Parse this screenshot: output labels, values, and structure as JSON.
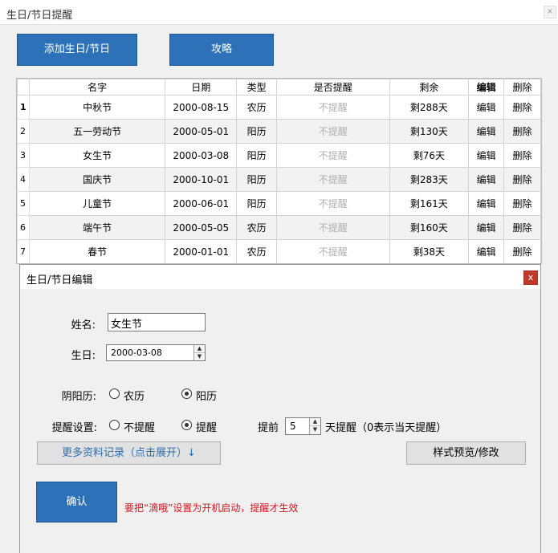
{
  "window": {
    "title": "生日/节日提醒",
    "close": "×"
  },
  "toolbar": {
    "add_label": "添加生日/节日",
    "guide_label": "攻略"
  },
  "table": {
    "headers": [
      "名字",
      "日期",
      "类型",
      "是否提醒",
      "剩余",
      "编辑",
      "删除"
    ],
    "rows": [
      {
        "num": "1",
        "name": "中秋节",
        "date": "2000-08-15",
        "type": "农历",
        "remind": "不提醒",
        "left": "剩288天",
        "edit": "编辑",
        "del": "删除"
      },
      {
        "num": "2",
        "name": "五一劳动节",
        "date": "2000-05-01",
        "type": "阳历",
        "remind": "不提醒",
        "left": "剩130天",
        "edit": "编辑",
        "del": "删除"
      },
      {
        "num": "3",
        "name": "女生节",
        "date": "2000-03-08",
        "type": "阳历",
        "remind": "不提醒",
        "left": "剩76天",
        "edit": "编辑",
        "del": "删除"
      },
      {
        "num": "4",
        "name": "国庆节",
        "date": "2000-10-01",
        "type": "阳历",
        "remind": "不提醒",
        "left": "剩283天",
        "edit": "编辑",
        "del": "删除"
      },
      {
        "num": "5",
        "name": "儿童节",
        "date": "2000-06-01",
        "type": "阳历",
        "remind": "不提醒",
        "left": "剩161天",
        "edit": "编辑",
        "del": "删除"
      },
      {
        "num": "6",
        "name": "端午节",
        "date": "2000-05-05",
        "type": "农历",
        "remind": "不提醒",
        "left": "剩160天",
        "edit": "编辑",
        "del": "删除"
      },
      {
        "num": "7",
        "name": "春节",
        "date": "2000-01-01",
        "type": "农历",
        "remind": "不提醒",
        "left": "剩38天",
        "edit": "编辑",
        "del": "删除"
      }
    ]
  },
  "dialog": {
    "title": "生日/节日编辑",
    "close": "x",
    "name_label": "姓名:",
    "name_value": "女生节",
    "birthday_label": "生日:",
    "birthday_value": "2000-03-08",
    "calendar_label": "阴阳历:",
    "calendar_options": [
      "农历",
      "阳历"
    ],
    "calendar_selected": "阳历",
    "remind_label": "提醒设置:",
    "remind_options": [
      "不提醒",
      "提醒"
    ],
    "remind_selected": "提醒",
    "advance_label": "提前",
    "advance_value": "5",
    "advance_suffix": "天提醒（0表示当天提醒）",
    "more_label": "更多资料记录（点击展开）↓",
    "style_label": "样式预览/修改",
    "confirm_label": "确认",
    "warning": "要把“滴哦”设置为开机启动，提醒才生效"
  },
  "colors": {
    "accent_blue": "#2d72b8",
    "warning_red": "#d4141e",
    "close_red": "#c0392b"
  }
}
